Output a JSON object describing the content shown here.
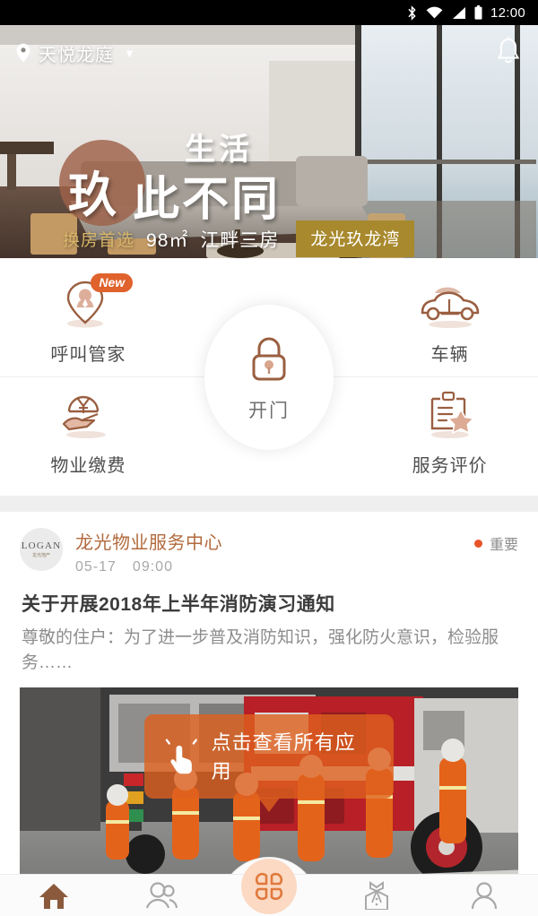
{
  "status_bar": {
    "time": "12:00",
    "icons": [
      "bluetooth-icon",
      "wifi-icon",
      "cellular-signal-icon",
      "battery-icon"
    ]
  },
  "header": {
    "location_icon": "location-pin-icon",
    "location_name": "天悦龙庭",
    "dropdown_caret": "▼",
    "notification_icon": "bell-icon"
  },
  "banner": {
    "hero_line1": "生活",
    "hero_line2": "玖",
    "hero_line3": "此不同",
    "sub_gold": "换房首选",
    "sub_area": "98㎡",
    "sub_rooms": "江畔三房",
    "cta_label": "龙光玖龙湾",
    "accent_circle_color": "#9e6048",
    "cta_bg": "#a8892d"
  },
  "quick_actions": {
    "items": [
      {
        "label": "呼叫管家",
        "icon": "butler-pin-icon",
        "badge": "New"
      },
      {
        "label": "车辆",
        "icon": "car-icon",
        "badge": ""
      },
      {
        "label": "物业缴费",
        "icon": "hand-yuan-coin-icon",
        "badge": ""
      },
      {
        "label": "服务评价",
        "icon": "clipboard-star-icon",
        "badge": ""
      }
    ],
    "center": {
      "label": "开门",
      "icon": "lock-icon"
    }
  },
  "news": {
    "avatar_text": "LOGAN",
    "avatar_subtext": "龙光地产",
    "source": "龙光物业服务中心",
    "date": "05-17",
    "time": "09:00",
    "flag_label": "重要",
    "flag_color": "#e8532a",
    "title": "关于开展2018年上半年消防演习通知",
    "body": "尊敬的住户：为了进一步普及消防知识，强化防火意识，检验服务……",
    "image_alt": "firefighters-drill-photo"
  },
  "tooltip": {
    "text": "点击查看所有应用",
    "icon": "tap-hand-icon",
    "bg_color": "#de601e"
  },
  "tabbar": {
    "items": [
      {
        "name": "home",
        "icon": "home-icon",
        "active": true
      },
      {
        "name": "community",
        "icon": "people-icon",
        "active": false
      },
      {
        "name": "apps",
        "icon": "clover-grid-icon",
        "active": false
      },
      {
        "name": "butler",
        "icon": "butler-suit-icon",
        "active": false
      },
      {
        "name": "profile",
        "icon": "person-icon",
        "active": false
      }
    ],
    "active_color": "#8b5a3c",
    "center_bg": "#fbd9c3"
  }
}
